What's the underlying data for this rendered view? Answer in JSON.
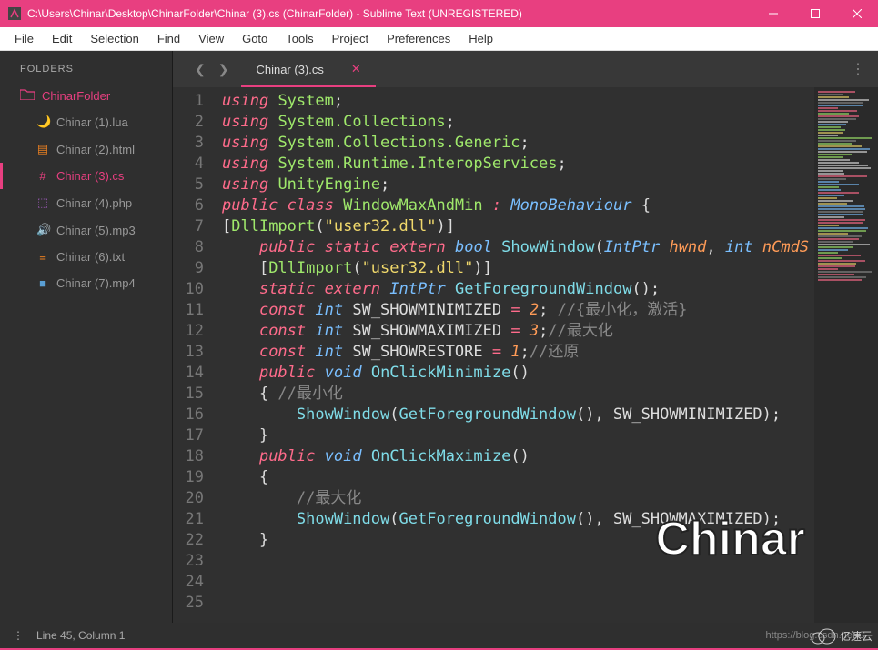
{
  "window": {
    "title": "C:\\Users\\Chinar\\Desktop\\ChinarFolder\\Chinar (3).cs (ChinarFolder) - Sublime Text (UNREGISTERED)"
  },
  "menubar": [
    "File",
    "Edit",
    "Selection",
    "Find",
    "View",
    "Goto",
    "Tools",
    "Project",
    "Preferences",
    "Help"
  ],
  "sidebar": {
    "header": "FOLDERS",
    "folder": "ChinarFolder",
    "files": [
      {
        "name": "Chinar (1).lua",
        "icon": "🌙",
        "color": "#5a9fd4"
      },
      {
        "name": "Chinar (2).html",
        "icon": "▤",
        "color": "#e67e22"
      },
      {
        "name": "Chinar (3).cs",
        "icon": "#",
        "color": "#e83f80",
        "active": true
      },
      {
        "name": "Chinar (4).php",
        "icon": "⬚",
        "color": "#9b59b6"
      },
      {
        "name": "Chinar (5).mp3",
        "icon": "🔊",
        "color": "#e74c3c"
      },
      {
        "name": "Chinar (6).txt",
        "icon": "≡",
        "color": "#e67e22"
      },
      {
        "name": "Chinar (7).mp4",
        "icon": "■",
        "color": "#5a9fd4"
      }
    ]
  },
  "tabs": {
    "active": "Chinar (3).cs"
  },
  "code": {
    "lines": [
      {
        "n": 1,
        "t": [
          [
            "kw",
            "using"
          ],
          [
            "",
            " "
          ],
          [
            "cls",
            "System"
          ],
          [
            "",
            ";"
          ]
        ]
      },
      {
        "n": 2,
        "t": [
          [
            "kw",
            "using"
          ],
          [
            "",
            " "
          ],
          [
            "cls",
            "System.Collections"
          ],
          [
            "",
            ";"
          ]
        ]
      },
      {
        "n": 3,
        "t": [
          [
            "kw",
            "using"
          ],
          [
            "",
            " "
          ],
          [
            "cls",
            "System.Collections.Generic"
          ],
          [
            "",
            ";"
          ]
        ]
      },
      {
        "n": 4,
        "t": [
          [
            "kw",
            "using"
          ],
          [
            "",
            " "
          ],
          [
            "cls",
            "System.Runtime.InteropServices"
          ],
          [
            "",
            ";"
          ]
        ]
      },
      {
        "n": 5,
        "t": [
          [
            "kw",
            "using"
          ],
          [
            "",
            " "
          ],
          [
            "cls",
            "UnityEngine"
          ],
          [
            "",
            ";"
          ]
        ]
      },
      {
        "n": 6,
        "t": [
          [
            "kw",
            "public"
          ],
          [
            "",
            " "
          ],
          [
            "kw",
            "class"
          ],
          [
            "",
            " "
          ],
          [
            "cls",
            "WindowMaxAndMin"
          ],
          [
            "",
            " "
          ],
          [
            "kw",
            ":"
          ],
          [
            "",
            " "
          ],
          [
            "type",
            "MonoBehaviour"
          ],
          [
            "",
            " {"
          ]
        ]
      },
      {
        "n": 7,
        "t": [
          [
            "",
            ""
          ],
          [
            "",
            "["
          ],
          [
            "attr",
            "DllImport"
          ],
          [
            "",
            "("
          ],
          [
            "str",
            "\"user32.dll\""
          ],
          [
            "",
            ")]"
          ]
        ]
      },
      {
        "n": 8,
        "t": [
          [
            "",
            "    "
          ],
          [
            "kw",
            "public"
          ],
          [
            "",
            " "
          ],
          [
            "kw",
            "static"
          ],
          [
            "",
            " "
          ],
          [
            "kw",
            "extern"
          ],
          [
            "",
            " "
          ],
          [
            "type",
            "bool"
          ],
          [
            "",
            " "
          ],
          [
            "func",
            "ShowWindow"
          ],
          [
            "",
            "("
          ],
          [
            "type",
            "IntPtr"
          ],
          [
            "",
            " "
          ],
          [
            "param",
            "hwnd"
          ],
          [
            "",
            ", "
          ],
          [
            "type",
            "int"
          ],
          [
            "",
            " "
          ],
          [
            "param",
            "nCmdS"
          ]
        ]
      },
      {
        "n": 9,
        "t": [
          [
            "",
            ""
          ]
        ]
      },
      {
        "n": 10,
        "t": [
          [
            "",
            "    ["
          ],
          [
            "attr",
            "DllImport"
          ],
          [
            "",
            "("
          ],
          [
            "str",
            "\"user32.dll\""
          ],
          [
            "",
            ")]"
          ]
        ]
      },
      {
        "n": 11,
        "t": [
          [
            "",
            "    "
          ],
          [
            "kw",
            "static"
          ],
          [
            "",
            " "
          ],
          [
            "kw",
            "extern"
          ],
          [
            "",
            " "
          ],
          [
            "type",
            "IntPtr"
          ],
          [
            "",
            " "
          ],
          [
            "func",
            "GetForegroundWindow"
          ],
          [
            "",
            "();"
          ]
        ]
      },
      {
        "n": 12,
        "t": [
          [
            "",
            ""
          ]
        ]
      },
      {
        "n": 13,
        "t": [
          [
            "",
            "    "
          ],
          [
            "kw",
            "const"
          ],
          [
            "",
            " "
          ],
          [
            "type",
            "int"
          ],
          [
            "",
            " SW_SHOWMINIMIZED "
          ],
          [
            "kw",
            "="
          ],
          [
            "",
            " "
          ],
          [
            "param",
            "2"
          ],
          [
            "",
            "; "
          ],
          [
            "comment",
            "//{最小化，激活}"
          ]
        ]
      },
      {
        "n": 14,
        "t": [
          [
            "",
            "    "
          ],
          [
            "kw",
            "const"
          ],
          [
            "",
            " "
          ],
          [
            "type",
            "int"
          ],
          [
            "",
            " SW_SHOWMAXIMIZED "
          ],
          [
            "kw",
            "="
          ],
          [
            "",
            " "
          ],
          [
            "param",
            "3"
          ],
          [
            "",
            ";"
          ],
          [
            "comment",
            "//最大化"
          ]
        ]
      },
      {
        "n": 15,
        "t": [
          [
            "",
            "    "
          ],
          [
            "kw",
            "const"
          ],
          [
            "",
            " "
          ],
          [
            "type",
            "int"
          ],
          [
            "",
            " SW_SHOWRESTORE "
          ],
          [
            "kw",
            "="
          ],
          [
            "",
            " "
          ],
          [
            "param",
            "1"
          ],
          [
            "",
            ";"
          ],
          [
            "comment",
            "//还原"
          ]
        ]
      },
      {
        "n": 16,
        "t": [
          [
            "",
            "    "
          ],
          [
            "kw",
            "public"
          ],
          [
            "",
            " "
          ],
          [
            "type",
            "void"
          ],
          [
            "",
            " "
          ],
          [
            "func",
            "OnClickMinimize"
          ],
          [
            "",
            "()"
          ]
        ]
      },
      {
        "n": 17,
        "t": [
          [
            "",
            "    { "
          ],
          [
            "comment",
            "//最小化"
          ]
        ]
      },
      {
        "n": 18,
        "t": [
          [
            "",
            "        "
          ],
          [
            "func",
            "ShowWindow"
          ],
          [
            "",
            "("
          ],
          [
            "func",
            "GetForegroundWindow"
          ],
          [
            "",
            "(), SW_SHOWMINIMIZED);"
          ]
        ]
      },
      {
        "n": 19,
        "t": [
          [
            "",
            "    }"
          ]
        ]
      },
      {
        "n": 20,
        "t": [
          [
            "",
            ""
          ]
        ]
      },
      {
        "n": 21,
        "t": [
          [
            "",
            "    "
          ],
          [
            "kw",
            "public"
          ],
          [
            "",
            " "
          ],
          [
            "type",
            "void"
          ],
          [
            "",
            " "
          ],
          [
            "func",
            "OnClickMaximize"
          ],
          [
            "",
            "()"
          ]
        ]
      },
      {
        "n": 22,
        "t": [
          [
            "",
            "    {"
          ]
        ]
      },
      {
        "n": 23,
        "t": [
          [
            "",
            "        "
          ],
          [
            "comment",
            "//最大化"
          ]
        ]
      },
      {
        "n": 24,
        "t": [
          [
            "",
            "        "
          ],
          [
            "func",
            "ShowWindow"
          ],
          [
            "",
            "("
          ],
          [
            "func",
            "GetForegroundWindow"
          ],
          [
            "",
            "(), SW_SHOWMAXIMIZED);"
          ]
        ]
      },
      {
        "n": 25,
        "t": [
          [
            "",
            "    }"
          ]
        ]
      }
    ]
  },
  "status": {
    "position": "Line 45, Column 1",
    "url": "https://blog.csdn.net/C"
  },
  "watermark": {
    "chinar": "Chinar",
    "cloud": "亿速云"
  }
}
